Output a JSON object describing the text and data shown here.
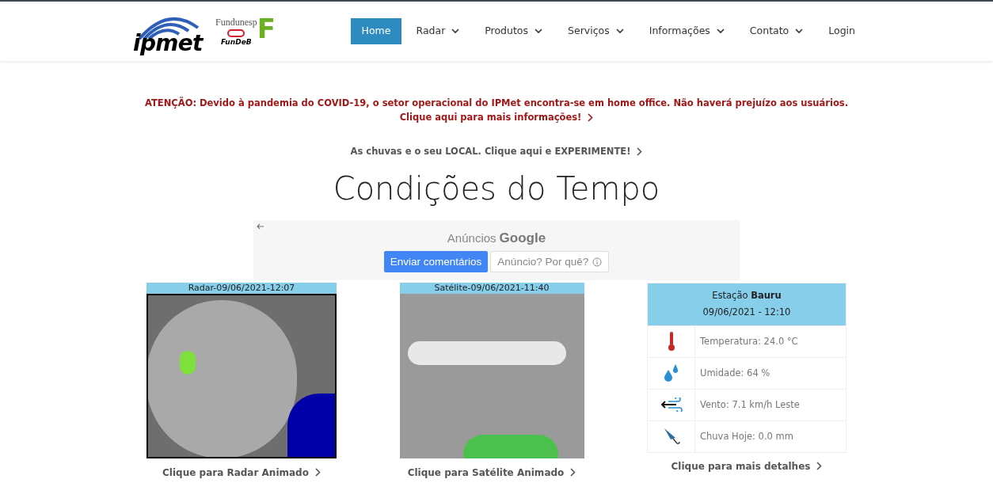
{
  "header": {
    "logo": {
      "main": "ipmet",
      "partner_top": "Fundunesp",
      "partner_letter": "F",
      "partner_bottom": "FunDeB"
    },
    "nav": [
      {
        "label": "Home",
        "selected": true,
        "dropdown": false
      },
      {
        "label": "Radar",
        "selected": false,
        "dropdown": true
      },
      {
        "label": "Produtos",
        "selected": false,
        "dropdown": true
      },
      {
        "label": "Serviços",
        "selected": false,
        "dropdown": true
      },
      {
        "label": "Informações",
        "selected": false,
        "dropdown": true
      },
      {
        "label": "Contato",
        "selected": false,
        "dropdown": true
      },
      {
        "label": "Login",
        "selected": false,
        "dropdown": false
      }
    ]
  },
  "notice": {
    "text": "ATENÇÃO: Devido à pandemia do COVID-19, o setor operacional do IPMet encontra-se em home office. Não haverá prejuízo aos usuários.",
    "link": "Clique aqui para mais informações!"
  },
  "promo_link": "As chuvas e o seu LOCAL. Clique aqui e EXPERIMENTE!",
  "title": "Condições do Tempo",
  "ad": {
    "label": "Anúncios",
    "brand": "Google",
    "buttons": [
      {
        "label": "Enviar comentários",
        "kind": "primary"
      },
      {
        "label": "Anúncio? Por quê?",
        "kind": "info"
      }
    ]
  },
  "panels": [
    {
      "kind": "radar",
      "caption": "Radar-09/06/2021-12:07",
      "link": "Clique para Radar Animado"
    },
    {
      "kind": "satellite",
      "caption": "Satélite-09/06/2021-11:40",
      "link": "Clique para Satélite Animado"
    }
  ],
  "station": {
    "label": "Estação",
    "name": "Bauru",
    "datetime": "09/06/2021 - 12:10",
    "rows": [
      {
        "kind": "temperature",
        "text": "Temperatura: 24.0 °C"
      },
      {
        "kind": "humidity",
        "text": "Umidade: 64 %"
      },
      {
        "kind": "wind",
        "text": "Vento: 7.1 km/h Leste"
      },
      {
        "kind": "rain",
        "text": "Chuva Hoje: 0.0 mm"
      }
    ],
    "link": "Clique para mais detalhes"
  }
}
